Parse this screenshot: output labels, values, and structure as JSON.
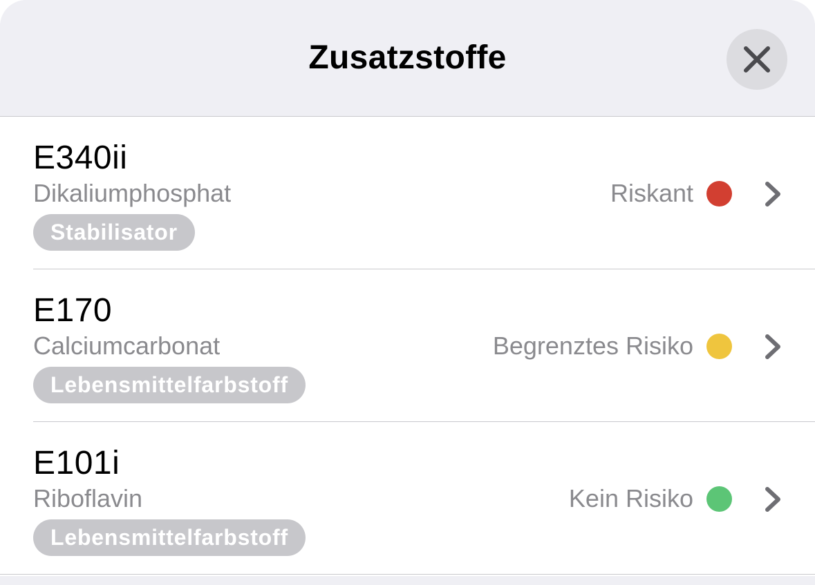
{
  "header": {
    "title": "Zusatzstoffe"
  },
  "items": [
    {
      "code": "E340ii",
      "name": "Dikaliumphosphat",
      "category": "Stabilisator",
      "risk_label": "Riskant",
      "risk_color": "#d23f31"
    },
    {
      "code": "E170",
      "name": "Calciumcarbonat",
      "category": "Lebensmittelfarbstoff",
      "risk_label": "Begrenztes Risiko",
      "risk_color": "#efc53e"
    },
    {
      "code": "E101i",
      "name": "Riboflavin",
      "category": "Lebensmittelfarbstoff",
      "risk_label": "Kein Risiko",
      "risk_color": "#5cc576"
    }
  ],
  "icons": {
    "close": "close-icon",
    "chevron": "chevron-right-icon"
  }
}
